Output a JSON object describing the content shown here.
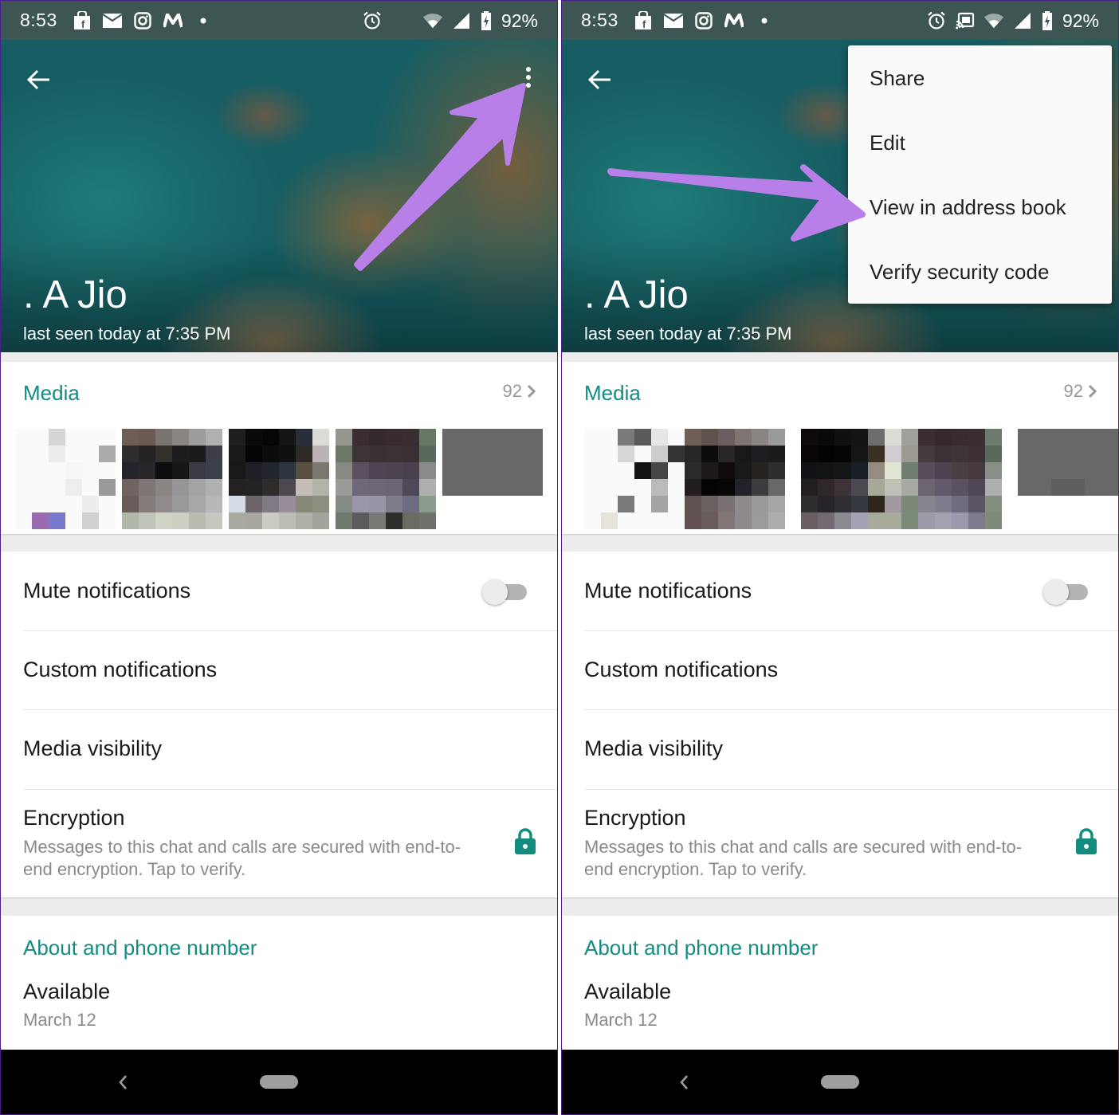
{
  "colors": {
    "accent": "#128c7e",
    "status_bar": "#3d5653",
    "annotation_arrow": "#b97fe8",
    "frame_border": "#4b1f8a",
    "secondary_text": "#8a8a8a"
  },
  "screens": [
    {
      "status_bar": {
        "time": "8:53",
        "notification_icons": [
          "shopping-bag-icon",
          "mail-icon",
          "instagram-icon",
          "myntra-icon",
          "dot-icon"
        ],
        "system_icons": [
          "alarm-icon",
          "wifi-icon",
          "cell-signal-icon",
          "battery-charging-icon"
        ],
        "battery": "92%"
      },
      "header": {
        "contact_name": ". A Jio",
        "last_seen": "last seen today at 7:35 PM",
        "back_icon": "arrow-left-icon",
        "more_icon": "more-vert-icon"
      },
      "media": {
        "title": "Media",
        "count": "92"
      },
      "settings": {
        "mute": {
          "label": "Mute notifications",
          "enabled": false
        },
        "custom": {
          "label": "Custom notifications"
        },
        "visibility": {
          "label": "Media visibility"
        },
        "encryption": {
          "label": "Encryption",
          "description": "Messages to this chat and calls are secured with end-to-end encryption. Tap to verify."
        }
      },
      "about": {
        "title": "About and phone number",
        "status": "Available",
        "date": "March 12"
      },
      "annotation": "Arrow pointing to more options menu"
    },
    {
      "status_bar": {
        "time": "8:53",
        "notification_icons": [
          "shopping-bag-icon",
          "mail-icon",
          "instagram-icon",
          "myntra-icon",
          "dot-icon"
        ],
        "system_icons": [
          "alarm-icon",
          "cast-icon",
          "wifi-icon",
          "cell-signal-icon",
          "battery-charging-icon"
        ],
        "battery": "92%"
      },
      "header": {
        "contact_name": ". A Jio",
        "last_seen": "last seen today at 7:35 PM",
        "back_icon": "arrow-left-icon"
      },
      "menu": {
        "items": [
          {
            "label": "Share"
          },
          {
            "label": "Edit"
          },
          {
            "label": "View in address book"
          },
          {
            "label": "Verify security code"
          }
        ]
      },
      "media": {
        "title": "Media",
        "count": "92"
      },
      "settings": {
        "mute": {
          "label": "Mute notifications",
          "enabled": false
        },
        "custom": {
          "label": "Custom notifications"
        },
        "visibility": {
          "label": "Media visibility"
        },
        "encryption": {
          "label": "Encryption",
          "description": "Messages to this chat and calls are secured with end-to-end encryption. Tap to verify."
        }
      },
      "about": {
        "title": "About and phone number",
        "status": "Available",
        "date": "March 12"
      },
      "annotation": "Arrow pointing to View in address book"
    }
  ]
}
